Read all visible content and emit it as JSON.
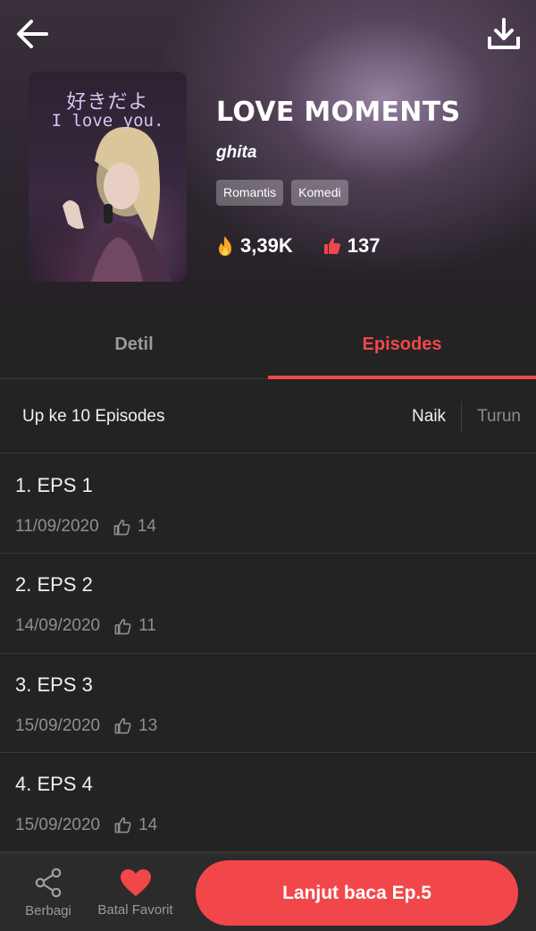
{
  "header": {
    "back_icon": "arrow-left-icon",
    "download_icon": "download-icon",
    "title": "LOVE MOMENTS",
    "author": "ghita",
    "tags": [
      "Romantis",
      "Komedi"
    ],
    "views": "3,39K",
    "likes": "137",
    "cover": {
      "line1": "好きだよ",
      "line2": "I love you."
    }
  },
  "tabs": [
    {
      "label": "Detil",
      "active": false
    },
    {
      "label": "Episodes",
      "active": true
    }
  ],
  "sort": {
    "count_label": "Up ke 10 Episodes",
    "asc_label": "Naik",
    "desc_label": "Turun",
    "selected": "Naik"
  },
  "episodes": [
    {
      "title": "1. EPS 1",
      "date": "11/09/2020",
      "likes": "14"
    },
    {
      "title": "2. EPS 2",
      "date": "14/09/2020",
      "likes": "11"
    },
    {
      "title": "3. EPS 3",
      "date": "15/09/2020",
      "likes": "13"
    },
    {
      "title": "4. EPS 4",
      "date": "15/09/2020",
      "likes": "14"
    }
  ],
  "bottom": {
    "share_label": "Berbagi",
    "unfavorite_label": "Batal Favorit",
    "cta_label": "Lanjut baca Ep.5"
  },
  "colors": {
    "accent": "#f0474a",
    "flame": "#f5a623",
    "background": "#232323"
  }
}
